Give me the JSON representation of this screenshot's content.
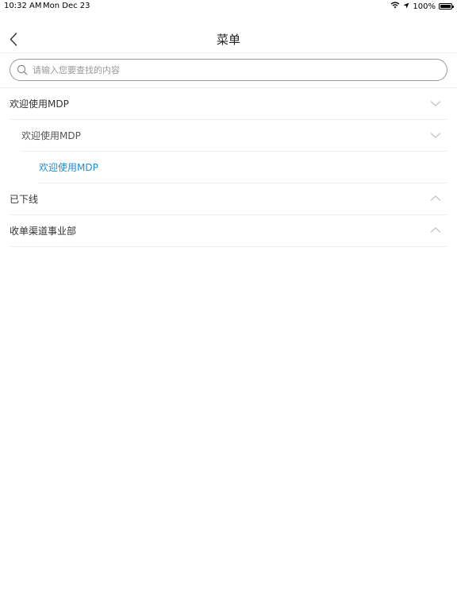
{
  "status_bar": {
    "time": "10:32 AM",
    "date": "Mon Dec 23",
    "battery": "100%"
  },
  "nav": {
    "title": "菜单",
    "back_icon": "chevron-left-icon"
  },
  "search": {
    "placeholder": "请输入您要查找的内容",
    "value": ""
  },
  "menu": {
    "items": [
      {
        "label": "欢迎使用MDP",
        "level": 0,
        "expanded": true
      },
      {
        "label": "欢迎使用MDP",
        "level": 1,
        "expanded": true
      },
      {
        "label": "欢迎使用MDP",
        "level": 2,
        "selected": true
      },
      {
        "label": "已下线",
        "level": 0,
        "expanded": false
      },
      {
        "label": "收单渠道事业部",
        "level": 0,
        "expanded": false
      }
    ]
  },
  "colors": {
    "accent": "#1a8de0",
    "divider": "#ececec",
    "chevron": "#c4c4c4"
  }
}
